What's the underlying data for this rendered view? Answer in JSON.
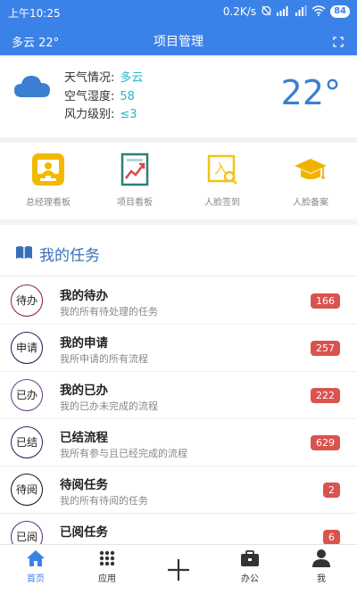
{
  "status_bar": {
    "time": "上午10:25",
    "speed": "0.2K/s",
    "battery": "84"
  },
  "app_bar": {
    "weather_short": "多云 22°",
    "title": "项目管理"
  },
  "weather": {
    "rows": [
      {
        "label": "天气情况:",
        "value": "多云"
      },
      {
        "label": "空气湿度:",
        "value": "58"
      },
      {
        "label": "风力级别:",
        "value": "≤3"
      }
    ],
    "temperature": "22°"
  },
  "quick_actions": [
    {
      "label": "总经理看板",
      "icon": "dashboard-icon"
    },
    {
      "label": "项目看板",
      "icon": "chart-board-icon"
    },
    {
      "label": "人脸签到",
      "icon": "face-signin-icon"
    },
    {
      "label": "人脸备案",
      "icon": "graduation-cap-icon"
    }
  ],
  "tasks": {
    "title": "我的任务",
    "items": [
      {
        "badge": "待办",
        "name": "我的待办",
        "desc": "我的所有待处理的任务",
        "count": "166",
        "color": "#8a1f3a"
      },
      {
        "badge": "申请",
        "name": "我的申请",
        "desc": "我所申请的所有流程",
        "count": "257",
        "color": "#1a1a5a"
      },
      {
        "badge": "已办",
        "name": "我的已办",
        "desc": "我的已办未完成的流程",
        "count": "222",
        "color": "#6a3a8a"
      },
      {
        "badge": "已结",
        "name": "已结流程",
        "desc": "我所有参与且已经完成的流程",
        "count": "629",
        "color": "#2a1a5a"
      },
      {
        "badge": "待阅",
        "name": "待阅任务",
        "desc": "我的所有待阅的任务",
        "count": "2",
        "color": "#111111"
      },
      {
        "badge": "已阅",
        "name": "已阅任务",
        "desc": "",
        "count": "6",
        "color": "#5a2a7a"
      }
    ]
  },
  "nav": {
    "items": [
      {
        "label": "首页",
        "icon": "home-icon"
      },
      {
        "label": "应用",
        "icon": "apps-grid-icon"
      },
      {
        "label": "",
        "icon": "plus-icon"
      },
      {
        "label": "办公",
        "icon": "briefcase-icon"
      },
      {
        "label": "我",
        "icon": "person-icon"
      }
    ]
  },
  "colors": {
    "primary": "#3b82e8",
    "badge": "#d9534f",
    "weather_value": "#28b6c9",
    "temperature": "#3a7fd0"
  }
}
